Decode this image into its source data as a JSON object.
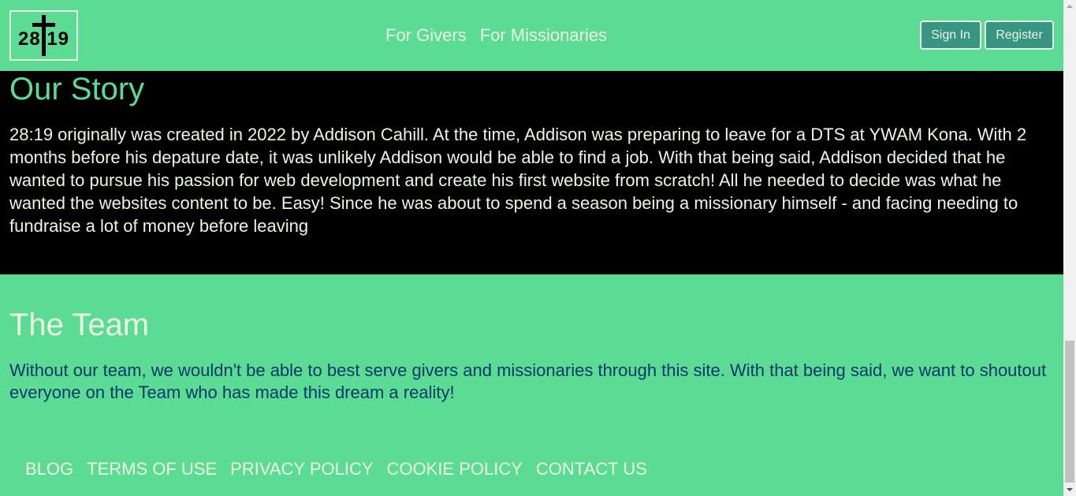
{
  "header": {
    "logo_text": "28 19",
    "nav": [
      {
        "label": "For Givers"
      },
      {
        "label": "For Missionaries"
      }
    ],
    "sign_in_label": "Sign In",
    "register_label": "Register"
  },
  "story": {
    "title": "Our Story",
    "text": "28:19 originally was created in 2022 by Addison Cahill. At the time, Addison was preparing to leave for a DTS at YWAM Kona. With 2 months before his depature date, it was unlikely Addison would be able to find a job. With that being said, Addison decided that he wanted to pursue his passion for web development and create his first website from scratch! All he needed to decide was what he wanted the websites content to be. Easy! Since he was about to spend a season being a missionary himself - and facing needing to fundraise a lot of money before leaving"
  },
  "team": {
    "title": "The Team",
    "text": "Without our team, we wouldn't be able to best serve givers and missionaries through this site. With that being said, we want to shoutout everyone on the Team who has made this dream a reality!"
  },
  "footer": {
    "links": [
      {
        "label": "BLOG"
      },
      {
        "label": "TERMS OF USE"
      },
      {
        "label": "PRIVACY POLICY"
      },
      {
        "label": "COOKIE POLICY"
      },
      {
        "label": "CONTACT US"
      }
    ]
  },
  "colors": {
    "brand_green": "#5cdb95",
    "button_teal": "#379683",
    "light_text": "#edf5e1",
    "dark_text": "#05386b",
    "story_bg": "#000000"
  }
}
